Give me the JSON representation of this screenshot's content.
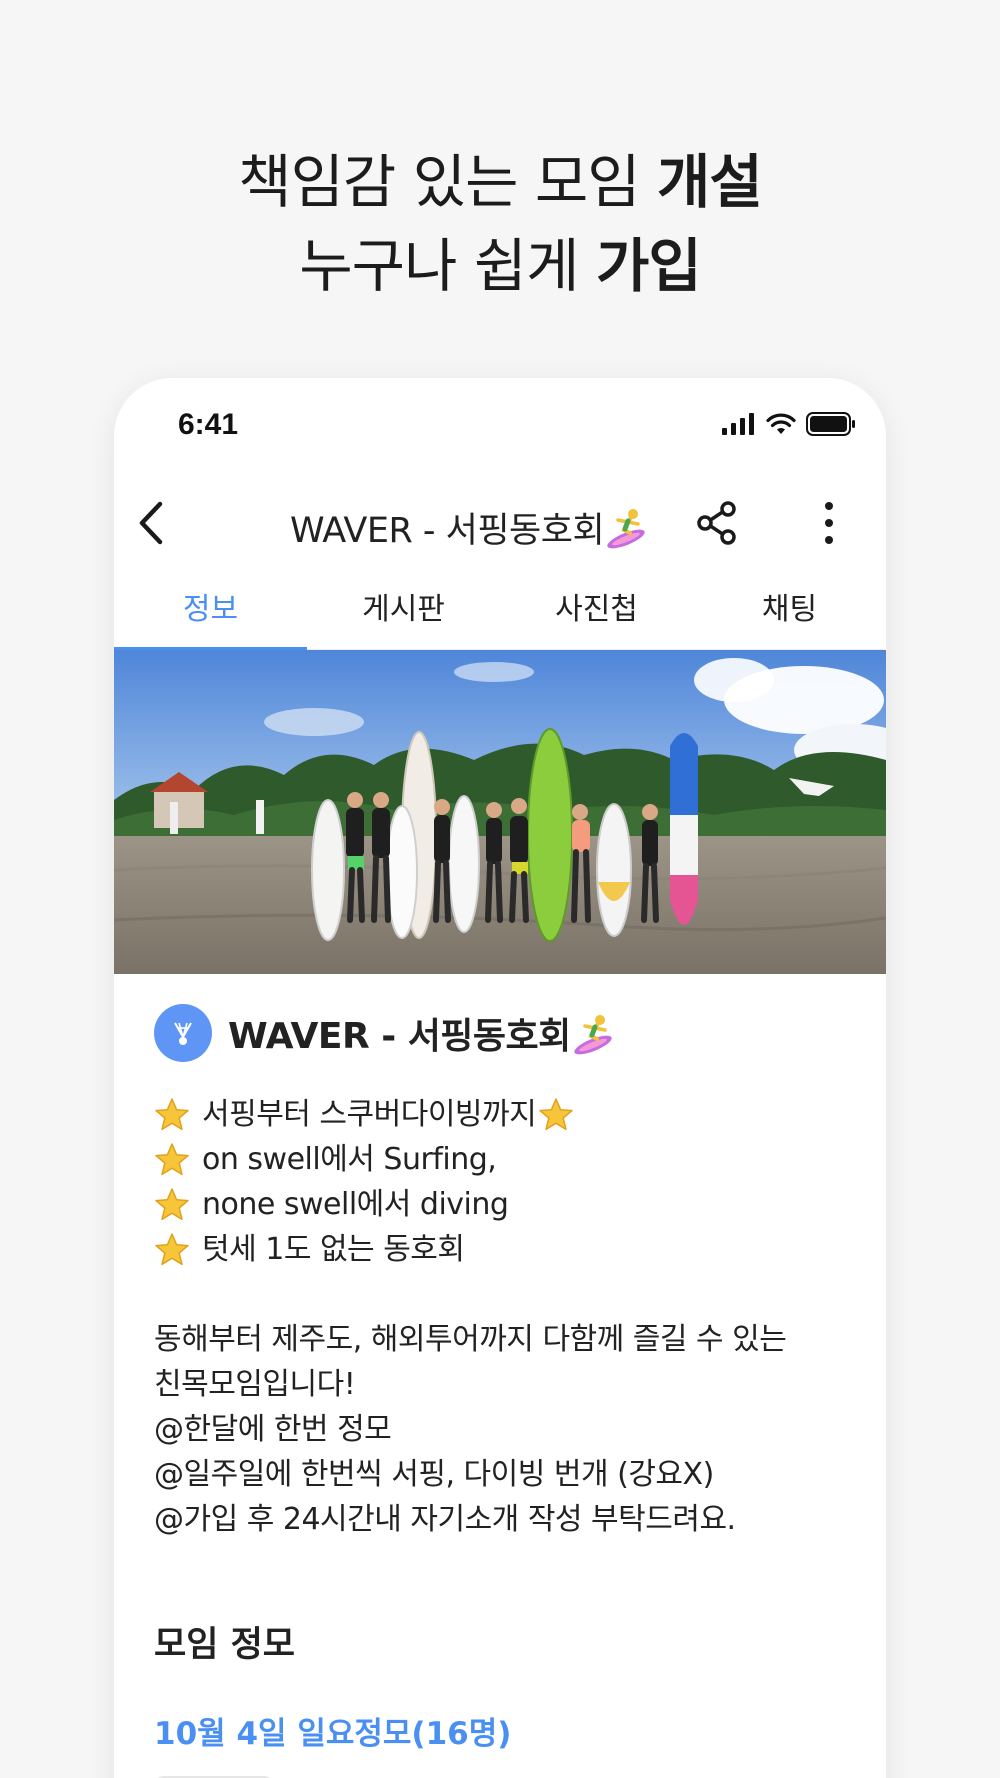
{
  "headline": {
    "line1_prefix": "책임감 있는 모임 ",
    "line1_bold": "개설",
    "line2_prefix": "누구나 쉽게 ",
    "line2_bold": "가입"
  },
  "status_bar": {
    "time": "6:41"
  },
  "appbar": {
    "title": "WAVER - 서핑동호회"
  },
  "tabs": [
    {
      "label": "정보",
      "active": true
    },
    {
      "label": "게시판",
      "active": false
    },
    {
      "label": "사진첩",
      "active": false
    },
    {
      "label": "채팅",
      "active": false
    }
  ],
  "club": {
    "name": "WAVER - 서핑동호회",
    "intro_lines": [
      "서핑부터 스쿠버다이빙까지",
      "on swell에서 Surfing,",
      "none swell에서 diving",
      "텃세 1도 없는 동호회"
    ],
    "body_lines": [
      "동해부터 제주도, 해외투어까지 다함께 즐길 수 있는",
      "친목모임입니다!",
      "@한달에 한번 정모",
      "@일주일에 한번씩 서핑, 다이빙 번개 (강요X)",
      "@가입 후 24시간내 자기소개 작성 부탁드려요."
    ]
  },
  "meetup": {
    "section_title": "모임 정모",
    "title": "10월 4일 일요정모(16명)"
  },
  "colors": {
    "accent": "#4a8ff2",
    "avatar": "#5f95f4",
    "background": "#f6f6f6"
  },
  "icons": [
    "back-arrow-icon",
    "share-icon",
    "more-vertical-icon",
    "surfer-emoji-icon",
    "star-emoji-icon",
    "badminton-shuttlecock-icon",
    "signal-icon",
    "wifi-icon",
    "battery-icon"
  ]
}
